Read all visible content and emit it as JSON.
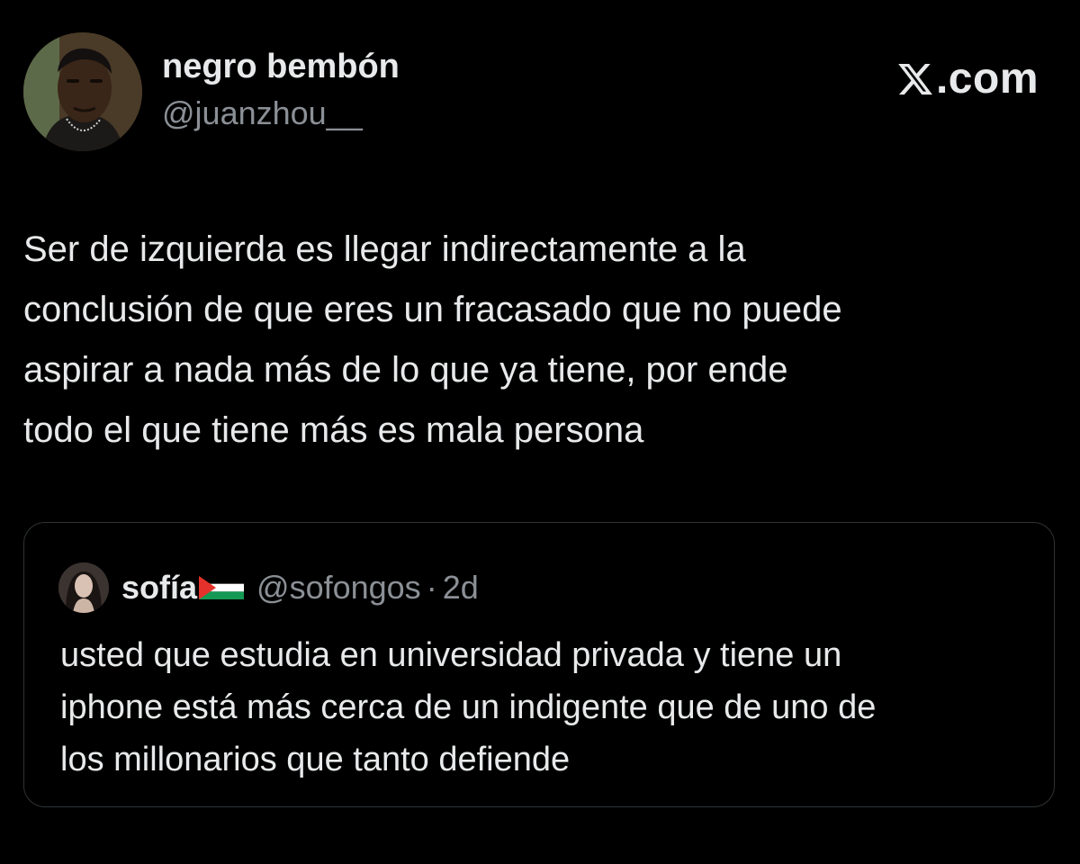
{
  "author": {
    "display_name": "negro bembón",
    "handle": "@juanzhou__",
    "avatar_icon": "profile-photo"
  },
  "source": {
    "logo_icon": "x-logo-icon",
    "text": ".com"
  },
  "tweet": {
    "lines": [
      "Ser de izquierda es llegar indirectamente a la",
      "conclusión de que eres un fracasado que no puede",
      "aspirar a nada más de lo que ya tiene, por ende",
      "todo el que tiene más es mala persona"
    ]
  },
  "quoted_tweet": {
    "display_name": "sofía",
    "flag_icon": "palestine-flag-icon",
    "handle": "@sofongos",
    "separator": "·",
    "time": "2d",
    "lines": [
      "usted que estudia en universidad privada y tiene un",
      "iphone está más cerca de un indigente que de uno de",
      "los millonarios que tanto defiende"
    ]
  },
  "colors": {
    "background": "#000000",
    "primary_text": "#e7e9ea",
    "secondary_text": "#8b9096",
    "border": "#2f3336",
    "flag_red": "#e4312b",
    "flag_green": "#149954"
  }
}
